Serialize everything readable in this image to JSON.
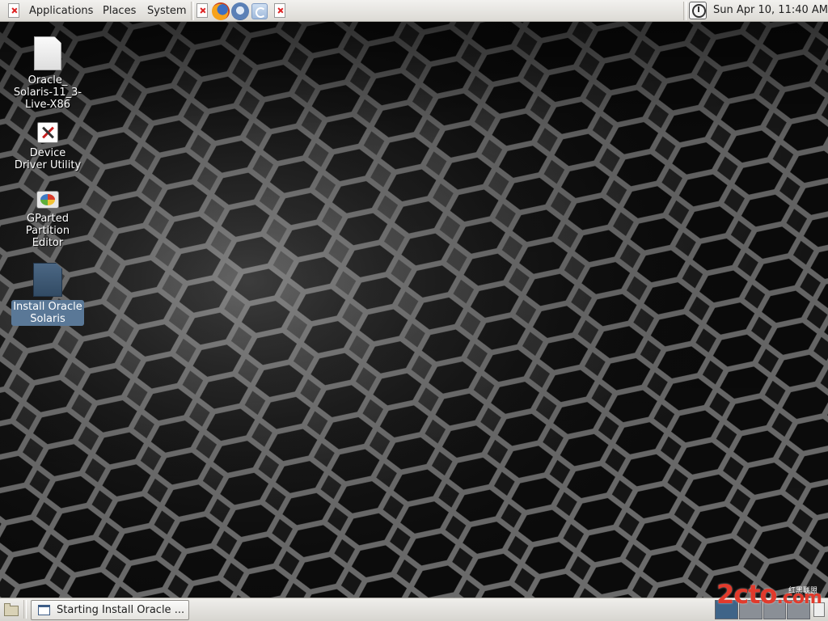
{
  "top_panel": {
    "menus": [
      "Applications",
      "Places",
      "System"
    ],
    "clock": "Sun Apr 10, 11:40 AM"
  },
  "desktop": {
    "icons": [
      {
        "label": "Oracle_ Solaris-11_3- Live-X86",
        "icon": "file-icon"
      },
      {
        "label": "Device Driver Utility",
        "icon": "device-driver-utility-icon"
      },
      {
        "label": "GParted Partition Editor",
        "icon": "gparted-icon"
      },
      {
        "label": "Install Oracle Solaris",
        "icon": "install-document-icon",
        "selected": true
      }
    ]
  },
  "taskbar": {
    "tasks": [
      {
        "label": "Starting Install Oracle ..."
      }
    ]
  },
  "watermark": {
    "text": "2cto",
    "suffix": ".com",
    "sub": "红黑联盟"
  },
  "colors": {
    "selection": "#5a7897",
    "watermark": "#e13a2c"
  }
}
